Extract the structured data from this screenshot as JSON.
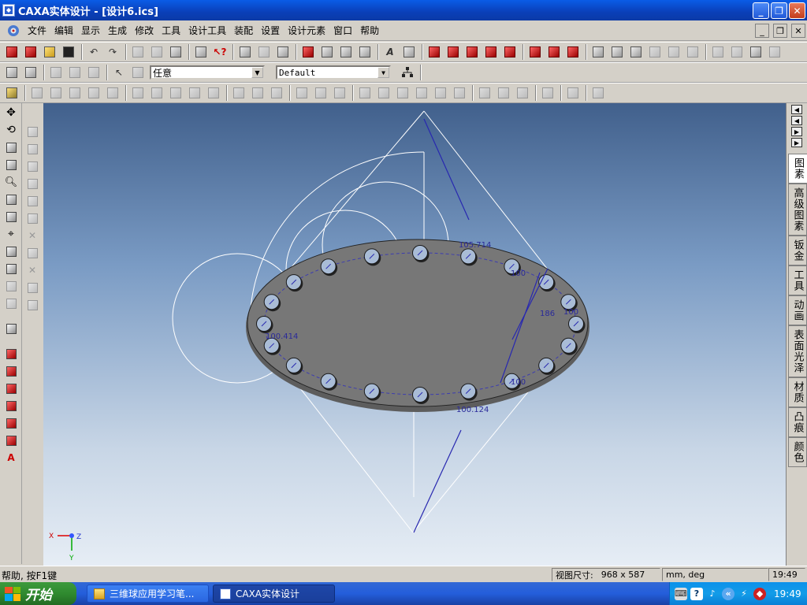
{
  "window": {
    "title": "CAXA实体设计 - [设计6.ics]",
    "buttons": {
      "minimize": "_",
      "restore": "❐",
      "close": "✕"
    }
  },
  "menu": {
    "items": [
      "文件",
      "编辑",
      "显示",
      "生成",
      "修改",
      "工具",
      "设计工具",
      "装配",
      "设置",
      "设计元素",
      "窗口",
      "帮助"
    ],
    "mdi_buttons": {
      "minimize": "_",
      "restore": "❐",
      "close": "✕"
    }
  },
  "toolbar3": {
    "select_filter": "任意",
    "config": "Default"
  },
  "design_elements_tabs": [
    "图素",
    "高级图素",
    "钣金",
    "工具",
    "动画",
    "表面光泽",
    "材质",
    "凸痕",
    "颜色"
  ],
  "viewport": {
    "dimensions": [
      "105.714",
      "100",
      "186",
      "100",
      "100.414",
      "100",
      "100.124"
    ],
    "axis": {
      "x": "X",
      "y": "Y",
      "z": "Z"
    }
  },
  "statusbar": {
    "help": "帮助, 按F1键",
    "view_size_label": "视图尺寸:",
    "view_size_value": "968 x 587",
    "units": "mm, deg",
    "time": "19:49"
  },
  "taskbar": {
    "start": "开始",
    "tasks": [
      "三维球应用学习笔...",
      "CAXA实体设计"
    ],
    "clock": "19:49"
  },
  "colors": {
    "title_bar": "#0a5ce6",
    "viewport_top": "#41608c",
    "viewport_bottom": "#e6edf5",
    "part_fill": "#6e6e6e",
    "dimension_text": "#2a2a9a"
  }
}
